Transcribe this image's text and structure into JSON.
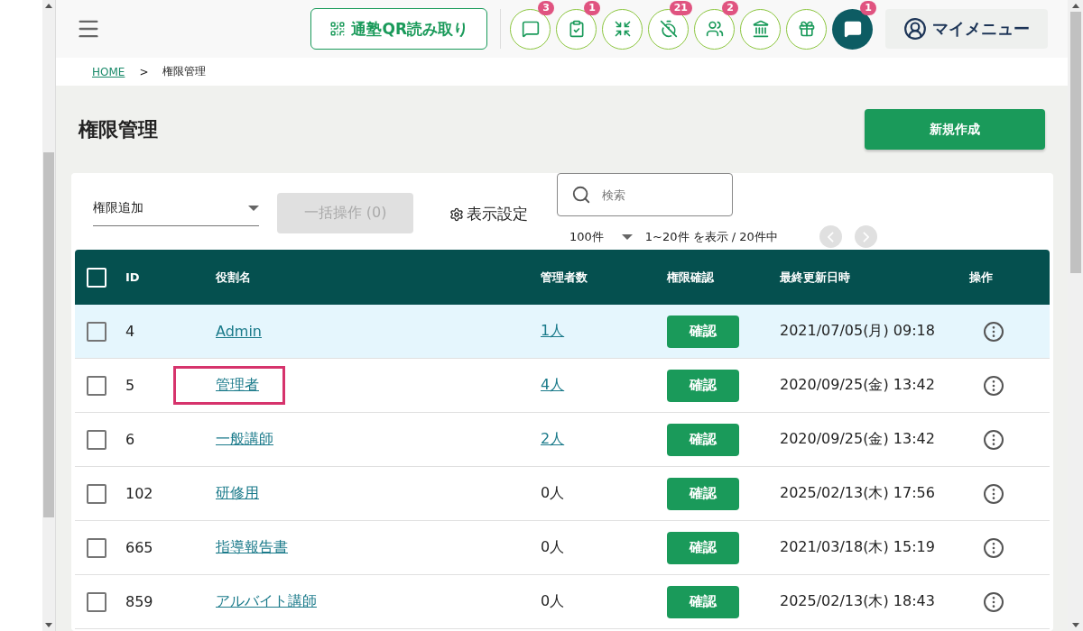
{
  "header": {
    "qr_button": "通塾QR読み取り",
    "icons": [
      {
        "badge": "3",
        "active": false
      },
      {
        "badge": "1",
        "active": false
      },
      {
        "active": false
      },
      {
        "badge": "21",
        "active": false
      },
      {
        "badge": "2",
        "active": false
      },
      {
        "active": false
      },
      {
        "active": false
      },
      {
        "badge": "1",
        "active": true
      }
    ],
    "my_menu": "マイメニュー"
  },
  "breadcrumb": {
    "home": "HOME",
    "separator": ">",
    "current": "権限管理"
  },
  "page_title": "権限管理",
  "new_button": "新規作成",
  "toolbar": {
    "role_select": "権限追加",
    "bulk_button": {
      "label": "一括操作 (0)",
      "disabled": true
    },
    "display_settings": "表示設定",
    "search": {
      "placeholder": "検索"
    },
    "per_page": "100件",
    "range": "1~20件 を表示 / 20件中"
  },
  "table": {
    "columns": [
      "ID",
      "役割名",
      "管理者数",
      "権限確認",
      "最終更新日時",
      "操作"
    ],
    "header_checked": false,
    "rows": [
      {
        "id": "4",
        "name": "Admin",
        "count": "1人",
        "count_linked": true,
        "confirm": "確認",
        "updated": "2021/07/05(月) 09:18",
        "checked": false,
        "highlighted": true,
        "annotated": false
      },
      {
        "id": "5",
        "name": "管理者",
        "count": "4人",
        "count_linked": true,
        "confirm": "確認",
        "updated": "2020/09/25(金) 13:42",
        "checked": false,
        "highlighted": false,
        "annotated": true
      },
      {
        "id": "6",
        "name": "一般講師",
        "count": "2人",
        "count_linked": true,
        "confirm": "確認",
        "updated": "2020/09/25(金) 13:42",
        "checked": false,
        "highlighted": false,
        "annotated": false
      },
      {
        "id": "102",
        "name": "研修用",
        "count": "0人",
        "count_linked": false,
        "confirm": "確認",
        "updated": "2025/02/13(木) 17:56",
        "checked": false,
        "highlighted": false,
        "annotated": false
      },
      {
        "id": "665",
        "name": "指導報告書",
        "count": "0人",
        "count_linked": false,
        "confirm": "確認",
        "updated": "2021/03/18(木) 15:19",
        "checked": false,
        "highlighted": false,
        "annotated": false
      },
      {
        "id": "859",
        "name": "アルバイト講師",
        "count": "0人",
        "count_linked": false,
        "confirm": "確認",
        "updated": "2025/02/13(木) 18:43",
        "checked": false,
        "highlighted": false,
        "annotated": false
      }
    ]
  }
}
